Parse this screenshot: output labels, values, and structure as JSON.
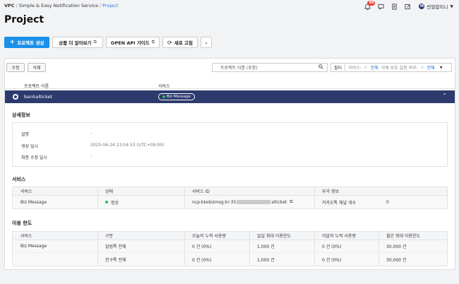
{
  "breadcrumb": {
    "root": "VPC",
    "sep": "/",
    "items": [
      "Simple & Easy Notification Service"
    ],
    "current": "Project"
  },
  "header": {
    "notification_count": "99",
    "user_name": "반말합미니"
  },
  "page": {
    "title": "Project"
  },
  "toolbar": {
    "create_label": "프로젝트 생성",
    "learn_more_label": "상품 더 알아보기",
    "api_guide_label": "OPEN API 가이드",
    "refresh_label": "새로 고침"
  },
  "actions": {
    "edit_label": "수정",
    "delete_label": "삭제",
    "search_placeholder": "프로젝트 이름 (포함)",
    "filter_label": "필터",
    "filter_service_label": "서비스:",
    "filter_service_value": "전체",
    "filter_delete_label": "삭제 보호 설정 여부:",
    "filter_delete_value": "전체"
  },
  "project_table": {
    "col_name": "프로젝트 이름",
    "col_service": "서비스",
    "selected": {
      "name": "banhalticket",
      "service_tag": "Biz Message"
    }
  },
  "details": {
    "section_title": "상세정보",
    "rows": [
      {
        "key": "설명",
        "value": "-"
      },
      {
        "key": "생성 일시",
        "value": "2025-06-24 23:04:53 (UTC+09:00)"
      },
      {
        "key": "최종 수정 일시",
        "value": "-"
      }
    ]
  },
  "services": {
    "section_title": "서비스",
    "headers": [
      "서비스",
      "상태",
      "서비스 ID",
      "부가 정보"
    ],
    "row": {
      "service": "Biz Message",
      "status": "정상",
      "id_prefix": "ncp:kkobizmsg:kr:35",
      "id_suffix": "alticket",
      "extra_key": "카카오톡 채널 개수",
      "extra_value": "0"
    }
  },
  "usage": {
    "section_title": "이용 한도",
    "headers": [
      "서비스",
      "구분",
      "오늘의 누적 사용량",
      "일일 최대 이용한도",
      "이달의 누적 사용량",
      "월간 최대 이용한도"
    ],
    "service": "Biz Message",
    "rows": [
      {
        "kind": "알림톡 전체",
        "today": "0 건 (0%)",
        "daily_max": "1,000 건",
        "month": "0 건 (0%)",
        "monthly_max": "30,000 건"
      },
      {
        "kind": "친구톡 전체",
        "today": "0 건 (0%)",
        "daily_max": "1,000 건",
        "month": "0 건 (0%)",
        "monthly_max": "30,000 건"
      }
    ]
  }
}
